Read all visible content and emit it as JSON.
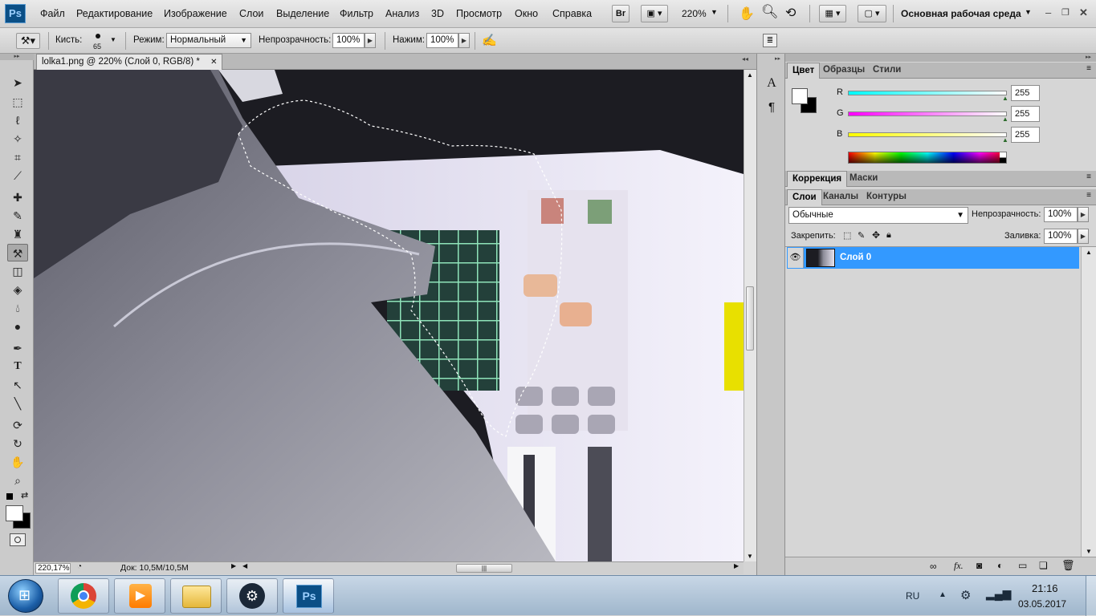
{
  "menubar": {
    "logo": "Ps",
    "items": [
      "Файл",
      "Редактирование",
      "Изображение",
      "Слои",
      "Выделение",
      "Фильтр",
      "Анализ",
      "3D",
      "Просмотр",
      "Окно",
      "Справка"
    ],
    "bridge_label": "Br",
    "zoom": "220%",
    "workspace": "Основная рабочая среда"
  },
  "options": {
    "brush_label": "Кисть:",
    "brush_size": "65",
    "mode_label": "Режим:",
    "mode_value": "Нормальный",
    "opacity_label": "Непрозрачность:",
    "opacity_value": "100%",
    "pressure_label": "Нажим:",
    "pressure_value": "100%"
  },
  "document": {
    "tab_title": "lolka1.png @ 220% (Слой 0, RGB/8) *",
    "zoom_status": "220,17%",
    "doc_size": "Док: 10,5M/10,5M"
  },
  "color_panel": {
    "tabs": [
      "Цвет",
      "Образцы",
      "Стили"
    ],
    "r_label": "R",
    "r_value": "255",
    "g_label": "G",
    "g_value": "255",
    "b_label": "B",
    "b_value": "255"
  },
  "adjust_panel": {
    "tabs": [
      "Коррекция",
      "Маски"
    ]
  },
  "layers_panel": {
    "tabs": [
      "Слои",
      "Каналы",
      "Контуры"
    ],
    "blend_mode": "Обычные",
    "opacity_label": "Непрозрачность:",
    "opacity_value": "100%",
    "lock_label": "Закрепить:",
    "fill_label": "Заливка:",
    "fill_value": "100%",
    "layers": [
      {
        "name": "Слой 0"
      }
    ]
  },
  "taskbar": {
    "lang": "RU",
    "time": "21:16",
    "date": "03.05.2017",
    "apps": [
      "start-orb",
      "chrome",
      "media-player",
      "explorer",
      "steam",
      "photoshop"
    ]
  },
  "colors": {
    "accent": "#3399ff",
    "ps_blue": "#0b4f86"
  }
}
